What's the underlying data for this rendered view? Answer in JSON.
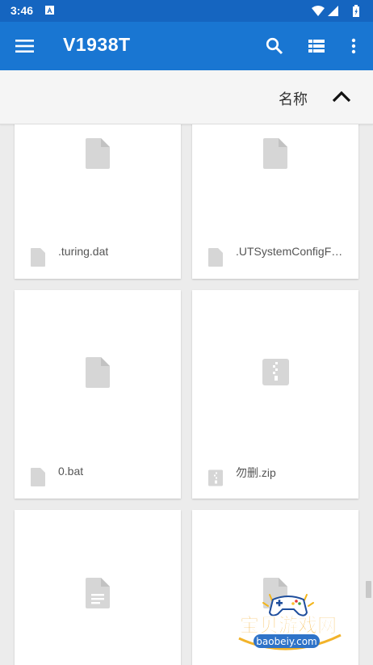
{
  "status_bar": {
    "time": "3:46",
    "notification_icon": "a-icon",
    "system_icons": [
      "wifi-icon",
      "signal-icon",
      "battery-icon"
    ]
  },
  "app_bar": {
    "title": "V1938T",
    "icons": [
      "menu-icon",
      "search-icon",
      "list-view-icon",
      "more-vert-icon"
    ],
    "color": "#1976d2",
    "status_color": "#1565c0"
  },
  "sort_bar": {
    "label": "名称",
    "direction_icon": "chevron-up-icon"
  },
  "files": [
    {
      "name": ".turing.dat",
      "icon": "file-icon"
    },
    {
      "name": ".UTSystemConfigFo…",
      "icon": "file-icon"
    },
    {
      "name": "0.bat",
      "icon": "file-icon"
    },
    {
      "name": "勿删.zip",
      "icon": "zip-icon"
    },
    {
      "name": "",
      "icon": "document-icon"
    },
    {
      "name": "",
      "icon": "file-icon"
    }
  ],
  "watermark": {
    "text": "宝贝游戏网",
    "url": "baobeiy.com"
  }
}
